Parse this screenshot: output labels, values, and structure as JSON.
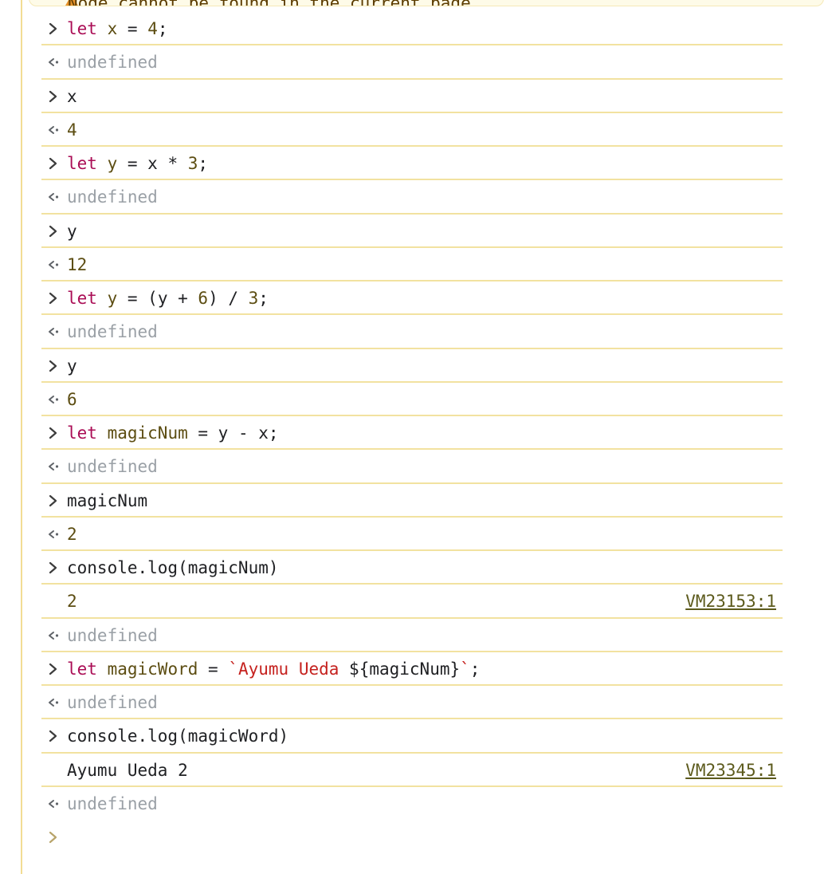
{
  "warning": {
    "text": "Node cannot be found in the current page."
  },
  "rows": [
    {
      "kind": "input",
      "tokens": [
        {
          "t": "kw",
          "v": "let"
        },
        {
          "t": "plain",
          "v": " "
        },
        {
          "t": "var",
          "v": "x"
        },
        {
          "t": "plain",
          "v": " = "
        },
        {
          "t": "num",
          "v": "4"
        },
        {
          "t": "plain",
          "v": ";"
        }
      ]
    },
    {
      "kind": "output",
      "tokens": [
        {
          "t": "undef",
          "v": "undefined"
        }
      ]
    },
    {
      "kind": "input",
      "tokens": [
        {
          "t": "plain",
          "v": "x"
        }
      ]
    },
    {
      "kind": "output",
      "tokens": [
        {
          "t": "result",
          "v": "4"
        }
      ]
    },
    {
      "kind": "input",
      "tokens": [
        {
          "t": "kw",
          "v": "let"
        },
        {
          "t": "plain",
          "v": " "
        },
        {
          "t": "var",
          "v": "y"
        },
        {
          "t": "plain",
          "v": " = x * "
        },
        {
          "t": "num",
          "v": "3"
        },
        {
          "t": "plain",
          "v": ";"
        }
      ]
    },
    {
      "kind": "output",
      "tokens": [
        {
          "t": "undef",
          "v": "undefined"
        }
      ]
    },
    {
      "kind": "input",
      "tokens": [
        {
          "t": "plain",
          "v": "y"
        }
      ]
    },
    {
      "kind": "output",
      "tokens": [
        {
          "t": "result",
          "v": "12"
        }
      ]
    },
    {
      "kind": "input",
      "tokens": [
        {
          "t": "kw",
          "v": "let"
        },
        {
          "t": "plain",
          "v": " "
        },
        {
          "t": "var",
          "v": "y"
        },
        {
          "t": "plain",
          "v": " = (y + "
        },
        {
          "t": "num",
          "v": "6"
        },
        {
          "t": "plain",
          "v": ") / "
        },
        {
          "t": "num",
          "v": "3"
        },
        {
          "t": "plain",
          "v": ";"
        }
      ]
    },
    {
      "kind": "output",
      "tokens": [
        {
          "t": "undef",
          "v": "undefined"
        }
      ]
    },
    {
      "kind": "input",
      "tokens": [
        {
          "t": "plain",
          "v": "y"
        }
      ]
    },
    {
      "kind": "output",
      "tokens": [
        {
          "t": "result",
          "v": "6"
        }
      ]
    },
    {
      "kind": "input",
      "tokens": [
        {
          "t": "kw",
          "v": "let"
        },
        {
          "t": "plain",
          "v": " "
        },
        {
          "t": "var",
          "v": "magicNum"
        },
        {
          "t": "plain",
          "v": " = y - x;"
        }
      ]
    },
    {
      "kind": "output",
      "tokens": [
        {
          "t": "undef",
          "v": "undefined"
        }
      ]
    },
    {
      "kind": "input",
      "tokens": [
        {
          "t": "plain",
          "v": "magicNum"
        }
      ]
    },
    {
      "kind": "output",
      "tokens": [
        {
          "t": "result",
          "v": "2"
        }
      ]
    },
    {
      "kind": "input",
      "tokens": [
        {
          "t": "plain",
          "v": "console.log(magicNum)"
        }
      ]
    },
    {
      "kind": "log",
      "tokens": [
        {
          "t": "result",
          "v": "2"
        }
      ],
      "link": "VM23153:1"
    },
    {
      "kind": "output",
      "tokens": [
        {
          "t": "undef",
          "v": "undefined"
        }
      ]
    },
    {
      "kind": "input",
      "tokens": [
        {
          "t": "kw",
          "v": "let"
        },
        {
          "t": "plain",
          "v": " "
        },
        {
          "t": "var",
          "v": "magicWord"
        },
        {
          "t": "plain",
          "v": " = "
        },
        {
          "t": "str",
          "v": "`Ayumu Ueda "
        },
        {
          "t": "plain",
          "v": "${magicNum}"
        },
        {
          "t": "str",
          "v": "`"
        },
        {
          "t": "plain",
          "v": ";"
        }
      ]
    },
    {
      "kind": "output",
      "tokens": [
        {
          "t": "undef",
          "v": "undefined"
        }
      ]
    },
    {
      "kind": "input",
      "tokens": [
        {
          "t": "plain",
          "v": "console.log(magicWord)"
        }
      ]
    },
    {
      "kind": "log",
      "tokens": [
        {
          "t": "plain",
          "v": "Ayumu Ueda 2"
        }
      ],
      "link": "VM23345:1"
    },
    {
      "kind": "output",
      "tokens": [
        {
          "t": "undef",
          "v": "undefined"
        }
      ]
    },
    {
      "kind": "prompt",
      "tokens": []
    }
  ],
  "colors": {
    "keyword": "#aa0d55",
    "variable": "#5c4d12",
    "string": "#c5221f",
    "undefined": "#9aa0a6",
    "divider": "#f2e2a0",
    "link": "#5c5a1c"
  },
  "icons": {
    "input": "chevron-right-icon",
    "output": "return-arrow-icon",
    "prompt": "prompt-chevron-icon",
    "warning": "warning-triangle-icon"
  }
}
